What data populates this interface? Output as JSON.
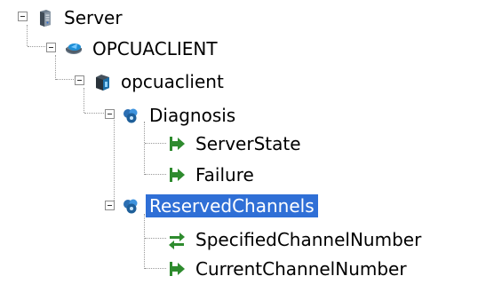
{
  "tree": {
    "nodes": [
      {
        "id": "server",
        "label": "Server",
        "icon": "server-icon",
        "expanded": true,
        "selected": false
      },
      {
        "id": "opcuaclient-upper",
        "label": "OPCUACLIENT",
        "icon": "connection-icon",
        "expanded": true,
        "selected": false
      },
      {
        "id": "opcuaclient-lower",
        "label": "opcuaclient",
        "icon": "device-icon",
        "expanded": true,
        "selected": false
      },
      {
        "id": "diagnosis",
        "label": "Diagnosis",
        "icon": "channel-group-icon",
        "expanded": true,
        "selected": false
      },
      {
        "id": "serverstate",
        "label": "ServerState",
        "icon": "arrow-right-icon",
        "selected": false
      },
      {
        "id": "failure",
        "label": "Failure",
        "icon": "arrow-right-icon",
        "selected": false
      },
      {
        "id": "reservedchannels",
        "label": "ReservedChannels",
        "icon": "channel-group-icon",
        "expanded": true,
        "selected": true
      },
      {
        "id": "specifiedchannelnumber",
        "label": "SpecifiedChannelNumber",
        "icon": "bidirectional-arrow-icon",
        "selected": false
      },
      {
        "id": "currentchannelnumber",
        "label": "CurrentChannelNumber",
        "icon": "arrow-right-icon",
        "selected": false
      }
    ]
  },
  "colors": {
    "selection": "#2f6fd6",
    "arrow": "#2e8b2e",
    "channel-group": "#2c6fb3"
  }
}
